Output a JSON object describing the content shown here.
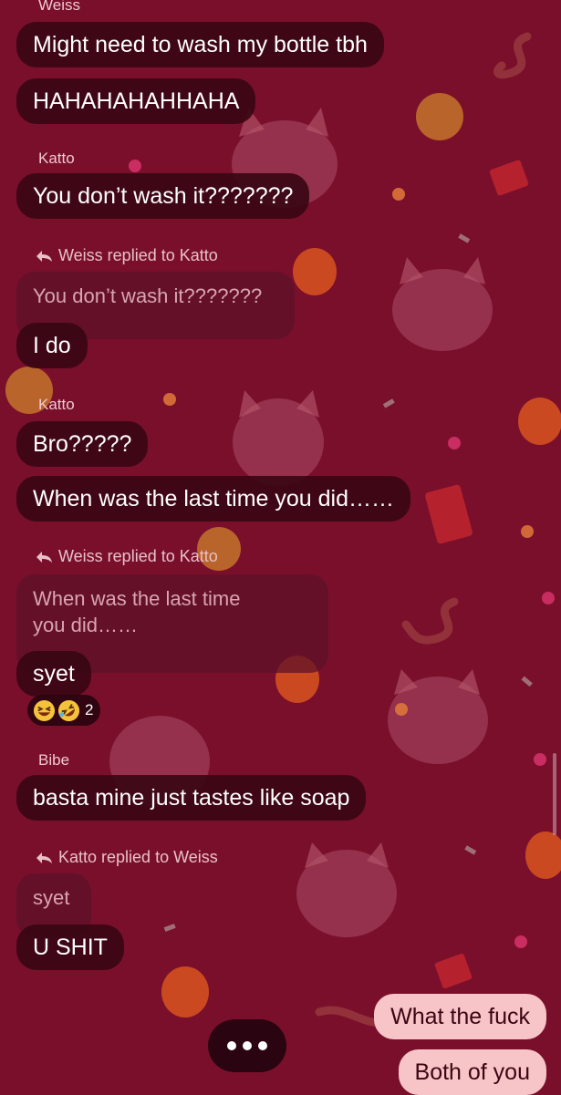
{
  "colors": {
    "background": "#7a0f2c",
    "incoming_bubble": "#3a0614",
    "outgoing_bubble": "#f7c4c8",
    "outgoing_text": "#3b0612",
    "quote_text": "#d8a5b2"
  },
  "messages": [
    {
      "sender": "Weiss",
      "text": "Might need to wash my bottle tbh"
    },
    {
      "text": "HAHAHAHAHHAHA"
    },
    {
      "sender": "Katto",
      "text": "You don’t wash it???????"
    },
    {
      "reply_label": "Weiss replied to Katto",
      "quote": "You don’t wash it???????",
      "text": "I do"
    },
    {
      "sender": "Katto",
      "text": "Bro?????"
    },
    {
      "text": "When was the last time you did……"
    },
    {
      "reply_label": "Weiss replied to Katto",
      "quote_line1": "When was the last time",
      "quote_line2": "you did……",
      "text": "syet"
    },
    {
      "reactions": {
        "emojis": [
          "grinning-squinting-face",
          "rolling-on-floor-laughing"
        ],
        "count": "2"
      }
    },
    {
      "sender": "Bibe",
      "text": "basta mine just tastes like soap"
    },
    {
      "reply_label": "Katto replied to Weiss",
      "quote": "syet",
      "text": "U SHIT"
    }
  ],
  "outgoing": [
    "What the fuck",
    "Both of you"
  ],
  "typing_indicator": {
    "icon": "typing-dots-icon"
  }
}
